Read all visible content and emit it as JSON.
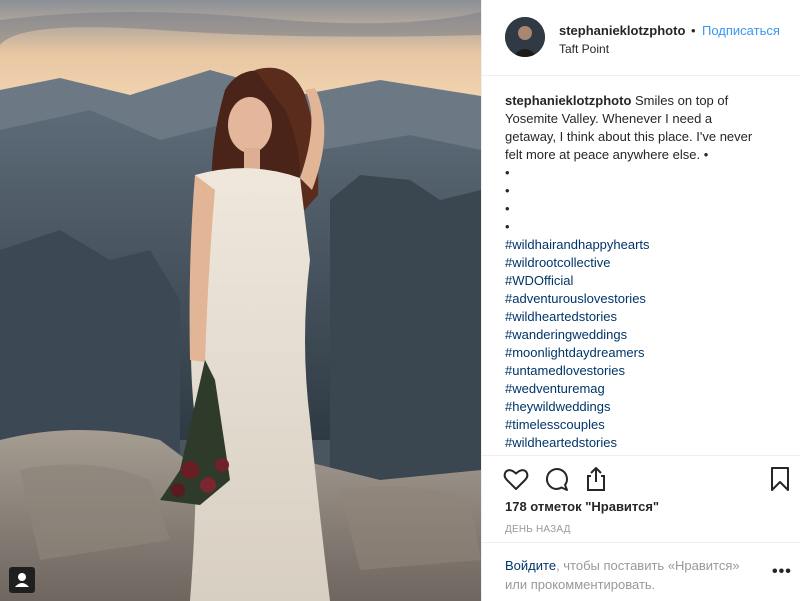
{
  "post": {
    "image_alt": "Bride in lace dress on cliff at sunset",
    "user_tag_icon": "person-icon"
  },
  "header": {
    "username": "stephanieklotzphoto",
    "separator": "•",
    "follow_label": "Подписаться",
    "location": "Taft Point"
  },
  "caption": {
    "username": "stephanieklotzphoto",
    "text_lines": [
      "Smiles on top of",
      "Yosemite Valley. Whenever I need a",
      "getaway, I think about this place. I've never",
      "felt more at peace anywhere else. •",
      "•",
      "•",
      "•",
      "•"
    ],
    "hashtags": [
      "#wildhairandhappyhearts",
      "#wildrootcollective",
      "#WDOfficial",
      "#adventurouslovestories",
      "#wildheartedstories",
      "#wanderingweddings",
      "#moonlightdaydreamers",
      "#untamedlovestories",
      "#wedventuremag",
      "#heywildweddings",
      "#timelesscouples",
      "#wildheartedstories"
    ]
  },
  "actions": {
    "like_icon": "heart-icon",
    "comment_icon": "comment-icon",
    "share_icon": "share-icon",
    "save_icon": "bookmark-icon"
  },
  "stats": {
    "likes_label": "178 отметок \"Нравится\"",
    "time_ago": "ДЕНЬ НАЗАД"
  },
  "comment": {
    "login_link": "Войдите",
    "login_text_rest": ", чтобы поставить «Нравится» или прокомментировать.",
    "more_label": "•••"
  },
  "colors": {
    "link_blue": "#3897f0",
    "hashtag": "#003569",
    "muted": "#999999",
    "border": "#efefef"
  }
}
